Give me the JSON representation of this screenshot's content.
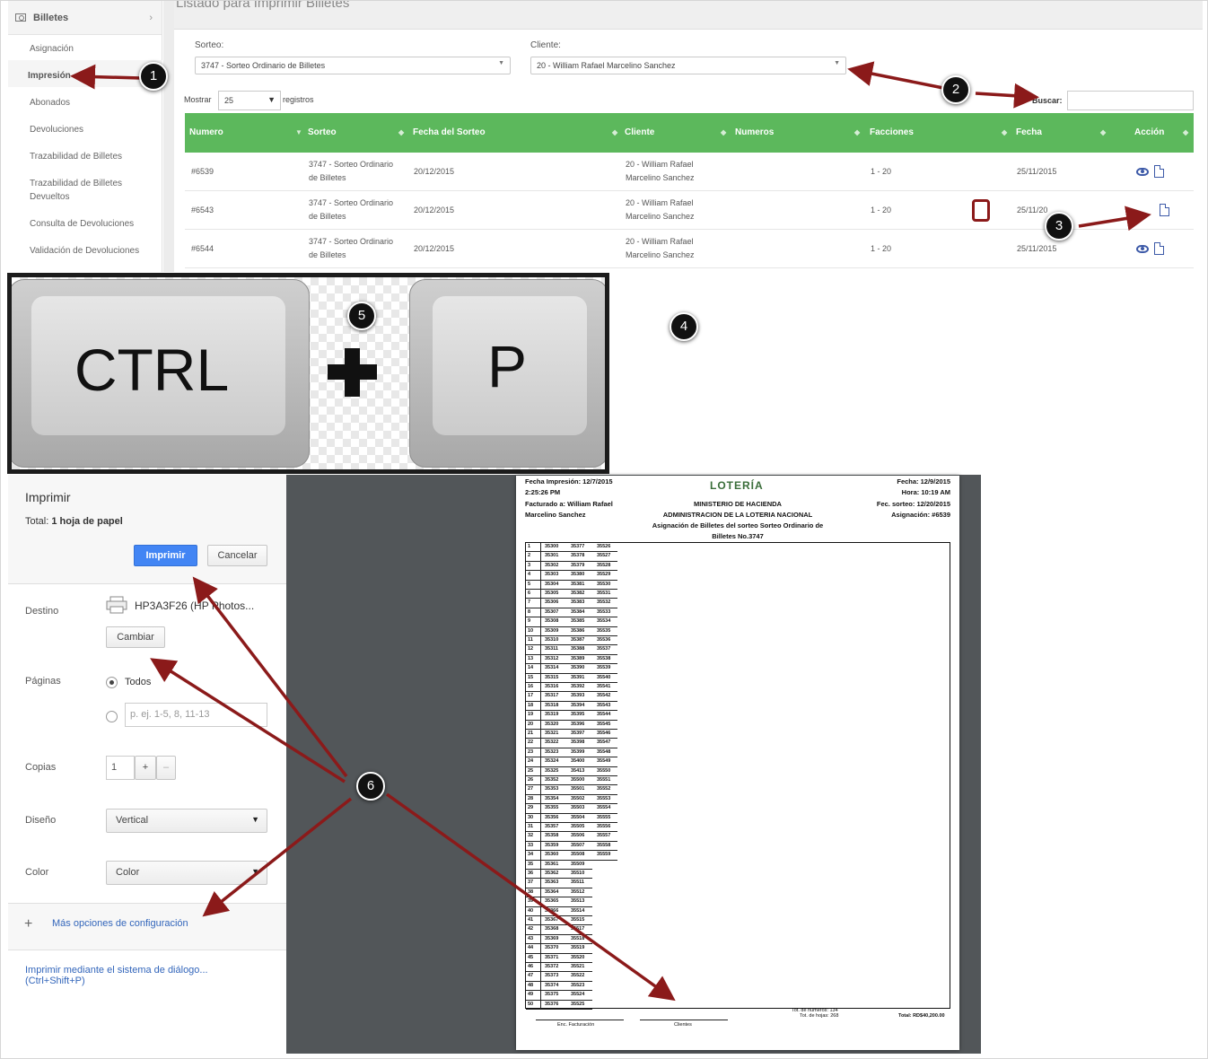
{
  "sidebar": {
    "section": "Billetes",
    "items": [
      {
        "label": "Asignación"
      },
      {
        "label": "Impresión"
      },
      {
        "label": "Abonados"
      },
      {
        "label": "Devoluciones"
      },
      {
        "label": "Trazabilidad de Billetes"
      },
      {
        "label": "Trazabilidad de Billetes Devueltos"
      },
      {
        "label": "Consulta de Devoluciones"
      },
      {
        "label": "Validación de Devoluciones"
      }
    ]
  },
  "main": {
    "title": "Listado para Imprimir Billetes",
    "sorteo_label": "Sorteo:",
    "sorteo_value": "3747 - Sorteo Ordinario de Billetes",
    "cliente_label": "Cliente:",
    "cliente_value": "20 - William Rafael Marcelino Sanchez",
    "mostrar": "Mostrar",
    "entries": "25",
    "registros": "registros",
    "buscar": "Buscar:",
    "columns": [
      "Numero",
      "Sorteo",
      "Fecha del Sorteo",
      "Cliente",
      "Numeros",
      "Facciones",
      "Fecha",
      "Acción"
    ],
    "rows": [
      {
        "numero": "#6539",
        "sorteo_1": "3747 - Sorteo Ordinario",
        "sorteo_2": "de Billetes",
        "fecha_sorteo": "20/12/2015",
        "cliente_1": "20 - William Rafael",
        "cliente_2": "Marcelino Sanchez",
        "numeros": "",
        "facciones": "1 - 20",
        "fecha": "25/11/2015"
      },
      {
        "numero": "#6543",
        "sorteo_1": "3747 - Sorteo Ordinario",
        "sorteo_2": "de Billetes",
        "fecha_sorteo": "20/12/2015",
        "cliente_1": "20 - William Rafael",
        "cliente_2": "Marcelino Sanchez",
        "numeros": "",
        "facciones": "1 - 20",
        "fecha": "25/11/20"
      },
      {
        "numero": "#6544",
        "sorteo_1": "3747 - Sorteo Ordinario",
        "sorteo_2": "de Billetes",
        "fecha_sorteo": "20/12/2015",
        "cliente_1": "20 - William Rafael",
        "cliente_2": "Marcelino Sanchez",
        "numeros": "",
        "facciones": "1 - 20",
        "fecha": "25/11/2015"
      }
    ],
    "header_color": "#5cb85c"
  },
  "keys": {
    "ctrl": "CTRL",
    "p": "P"
  },
  "print_dialog": {
    "title": "Imprimir",
    "total_prefix": "Total: ",
    "total_value": "1 hoja de papel",
    "print_button": "Imprimir",
    "cancel_button": "Cancelar",
    "destino_label": "Destino",
    "printer": "HP3A3F26 (HP Photos...",
    "change_button": "Cambiar",
    "paginas_label": "Páginas",
    "todos": "Todos",
    "pages_placeholder": "p. ej. 1-5, 8, 11-13",
    "copias_label": "Copias",
    "copies": "1",
    "plus": "+",
    "minus": "–",
    "diseno_label": "Diseño",
    "layout": "Vertical",
    "color_label": "Color",
    "color": "Color",
    "more_options": "Más opciones de configuración",
    "system_dialog_1": "Imprimir mediante el sistema de diálogo...",
    "system_dialog_2": "(Ctrl+Shift+P)",
    "accent": "#4285f4"
  },
  "preview": {
    "fecha_impresion": "Fecha Impresión: 12/7/2015",
    "hora_impresion": "2:25:26 PM",
    "facturado": "Facturado a: William Rafael",
    "facturado_2": "Marcelino Sanchez",
    "logo": "LOTERÍA",
    "ministerio": "MINISTERIO DE HACIENDA",
    "administracion": "ADMINISTRACION DE LA LOTERIA NACIONAL",
    "asignacion_title": "Asignación de Billetes del sorteo Sorteo Ordinario de",
    "asignacion_title_2": "Billetes No.3747",
    "fecha": "Fecha: 12/9/2015",
    "hora": "Hora: 10:19 AM",
    "fec_sorteo": "Fec. sorteo: 12/20/2015",
    "asignacion_num": "Asignación: #6539",
    "tot_numeros": "Tot. de numeros: 134",
    "tot_hojas": "Tot. de hojas: 268",
    "total": "Total: RD$40,200.00",
    "enc_facturacion": "Enc. Facturación",
    "clientes": "Clientes",
    "rows": [
      [
        "1",
        "35300",
        "35377",
        "35526"
      ],
      [
        "2",
        "35301",
        "35378",
        "35527"
      ],
      [
        "3",
        "35302",
        "35379",
        "35528"
      ],
      [
        "4",
        "35303",
        "35380",
        "35529"
      ],
      [
        "5",
        "35304",
        "35381",
        "35530"
      ],
      [
        "6",
        "35305",
        "35382",
        "35531"
      ],
      [
        "7",
        "35306",
        "35383",
        "35532"
      ],
      [
        "8",
        "35307",
        "35384",
        "35533"
      ],
      [
        "9",
        "35308",
        "35385",
        "35534"
      ],
      [
        "10",
        "35309",
        "35386",
        "35535"
      ],
      [
        "11",
        "35310",
        "35387",
        "35536"
      ],
      [
        "12",
        "35311",
        "35388",
        "35537"
      ],
      [
        "13",
        "35312",
        "35389",
        "35538"
      ],
      [
        "14",
        "35314",
        "35390",
        "35539"
      ],
      [
        "15",
        "35315",
        "35391",
        "35540"
      ],
      [
        "16",
        "35316",
        "35392",
        "35541"
      ],
      [
        "17",
        "35317",
        "35393",
        "35542"
      ],
      [
        "18",
        "35318",
        "35394",
        "35543"
      ],
      [
        "19",
        "35319",
        "35395",
        "35544"
      ],
      [
        "20",
        "35320",
        "35396",
        "35545"
      ],
      [
        "21",
        "35321",
        "35397",
        "35546"
      ],
      [
        "22",
        "35322",
        "35398",
        "35547"
      ],
      [
        "23",
        "35323",
        "35399",
        "35548"
      ],
      [
        "24",
        "35324",
        "35400",
        "35549"
      ],
      [
        "25",
        "35325",
        "35413",
        "35550"
      ],
      [
        "26",
        "35352",
        "35500",
        "35551"
      ],
      [
        "27",
        "35353",
        "35501",
        "35552"
      ],
      [
        "28",
        "35354",
        "35502",
        "35553"
      ],
      [
        "29",
        "35355",
        "35503",
        "35554"
      ],
      [
        "30",
        "35356",
        "35504",
        "35555"
      ],
      [
        "31",
        "35357",
        "35505",
        "35556"
      ],
      [
        "32",
        "35358",
        "35506",
        "35557"
      ],
      [
        "33",
        "35359",
        "35507",
        "35558"
      ],
      [
        "34",
        "35360",
        "35508",
        "35559"
      ],
      [
        "35",
        "35361",
        "35509",
        ""
      ],
      [
        "36",
        "35362",
        "35510",
        ""
      ],
      [
        "37",
        "35363",
        "35511",
        ""
      ],
      [
        "38",
        "35364",
        "35512",
        ""
      ],
      [
        "39",
        "35365",
        "35513",
        ""
      ],
      [
        "40",
        "35366",
        "35514",
        ""
      ],
      [
        "41",
        "35367",
        "35515",
        ""
      ],
      [
        "42",
        "35368",
        "35517",
        ""
      ],
      [
        "43",
        "35369",
        "35518",
        ""
      ],
      [
        "44",
        "35370",
        "35519",
        ""
      ],
      [
        "45",
        "35371",
        "35520",
        ""
      ],
      [
        "46",
        "35372",
        "35521",
        ""
      ],
      [
        "47",
        "35373",
        "35522",
        ""
      ],
      [
        "48",
        "35374",
        "35523",
        ""
      ],
      [
        "49",
        "35375",
        "35524",
        ""
      ],
      [
        "50",
        "35376",
        "35525",
        ""
      ]
    ]
  },
  "markers": [
    "1",
    "2",
    "3",
    "4",
    "5",
    "6"
  ],
  "arrow_color": "#8b1a1a"
}
